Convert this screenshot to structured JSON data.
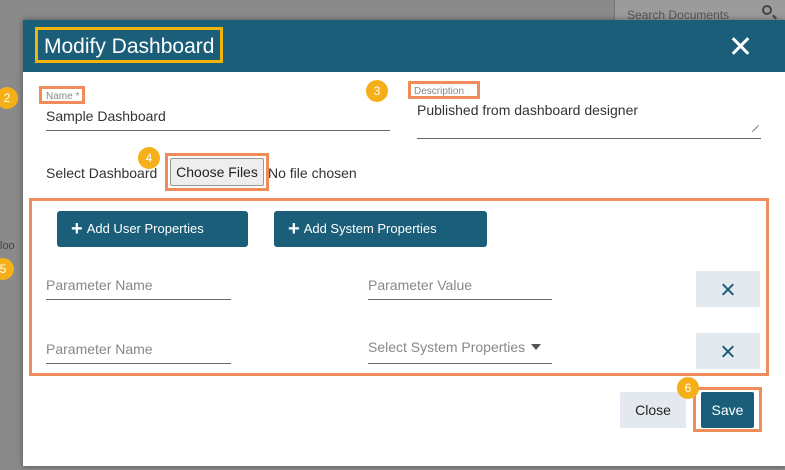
{
  "background": {
    "search_placeholder": "Search Documents",
    "side_fragment": "loo"
  },
  "dialog": {
    "title": "Modify Dashboard",
    "name_label": "Name *",
    "name_value": "Sample Dashboard",
    "description_label": "Description",
    "description_value": "Published from dashboard designer",
    "select_dashboard_label": "Select Dashboard",
    "choose_files_label": "Choose Files",
    "no_file_text": "No file chosen",
    "add_user_props_label": "Add User Properties",
    "add_system_props_label": "Add System Properties",
    "param_name_placeholder_1": "Parameter Name",
    "param_value_placeholder": "Parameter Value",
    "param_name_placeholder_2": "Parameter Name",
    "system_props_placeholder": "Select System Properties",
    "close_label": "Close",
    "save_label": "Save"
  },
  "callouts": [
    "2",
    "3",
    "4",
    "5",
    "6"
  ],
  "colors": {
    "header": "#1b5e7a",
    "title_highlight": "#f0b40a",
    "callout_box": "#f08c5a",
    "badge": "#f5b019"
  }
}
